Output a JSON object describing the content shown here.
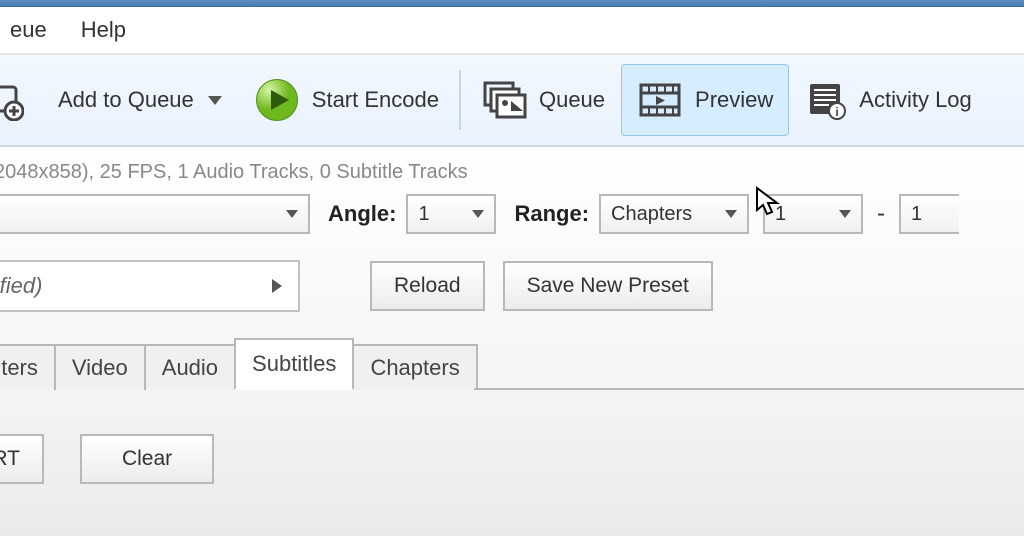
{
  "menubar": {
    "items": [
      "eue",
      "Help"
    ]
  },
  "toolbar": {
    "add_queue": "Add to Queue",
    "start_encode": "Start Encode",
    "queue": "Queue",
    "preview": "Preview",
    "activity_log": "Activity Log"
  },
  "status_line": "2048x858), 25 FPS, 1 Audio Tracks, 0 Subtitle Tracks",
  "source_row": {
    "angle_label": "Angle:",
    "angle_value": "1",
    "range_label": "Range:",
    "range_type": "Chapters",
    "range_start": "1",
    "range_sep": "-",
    "range_end": "1"
  },
  "preset_row": {
    "preset_text": "Modified)",
    "reload": "Reload",
    "save_new_preset": "Save New Preset"
  },
  "tabs": {
    "filters": "Filters",
    "video": "Video",
    "audio": "Audio",
    "subtitles": "Subtitles",
    "chapters": "Chapters",
    "active": "subtitles"
  },
  "subtitle_buttons": {
    "import_srt": "ort SRT",
    "clear": "Clear"
  }
}
